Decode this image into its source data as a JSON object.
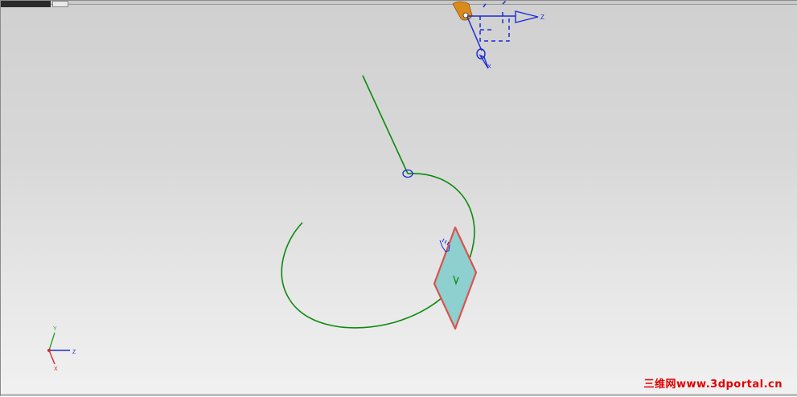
{
  "viewport": {
    "background_top": "#d0d0d0",
    "background_bottom": "#f1f1f1"
  },
  "colors": {
    "curve": "#0a8a0a",
    "csys": "#1a2bd6",
    "plane_fill": "#8ecfcf",
    "plane_edge": "#d9534f",
    "triad_x": "#d62828",
    "triad_y": "#2ca02c",
    "triad_z": "#1a2bd6",
    "watermark": "#e00000",
    "handle": "#d98a1a"
  },
  "dynamic_csys": {
    "z_label": "Z",
    "x_label": "X"
  },
  "view_triad": {
    "x_label": "X",
    "y_label": "Y",
    "z_label": "Z"
  },
  "icons": {
    "drag_handle": "orange-drag-handle-icon",
    "point_marker": "circle-point-icon",
    "cursor": "hand-cursor-icon"
  },
  "watermark": {
    "text": "三维网www.3dportal.cn"
  }
}
